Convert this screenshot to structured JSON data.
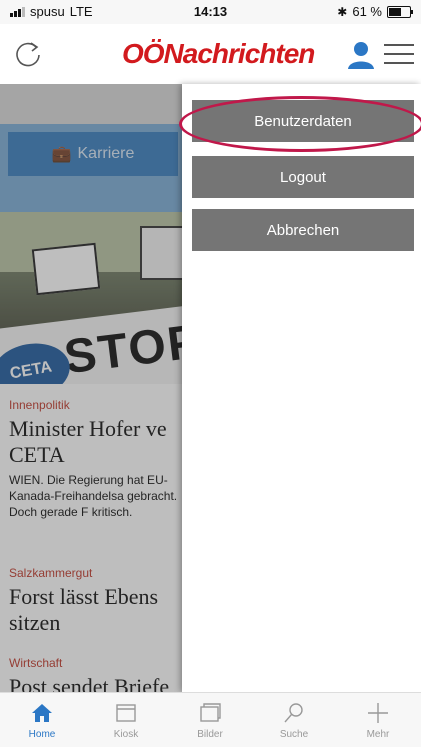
{
  "status": {
    "carrier": "spusu",
    "network": "LTE",
    "time": "14:13",
    "battery": "61 %",
    "battery_level": 0.61
  },
  "header": {
    "logo": "OÖNachrichten"
  },
  "background": {
    "karriere": "Karriere",
    "photo_text": {
      "banner": "STOPP",
      "badge": "CETA"
    },
    "articles": [
      {
        "category": "Innenpolitik",
        "headline": "Minister Hofer ve CETA",
        "teaser": "WIEN. Die Regierung hat EU-Kanada-Freihandelsa gebracht. Doch gerade F kritisch."
      },
      {
        "category": "Salzkammergut",
        "headline": "Forst lässt Ebens sitzen"
      },
      {
        "category": "Wirtschaft",
        "headline": "Post sendet Briefe"
      }
    ]
  },
  "menu": {
    "items": [
      "Benutzerdaten",
      "Logout",
      "Abbrechen"
    ]
  },
  "tabbar": {
    "tabs": [
      "Home",
      "Kiosk",
      "Bilder",
      "Suche",
      "Mehr"
    ]
  },
  "colors": {
    "brand": "#d21a1e",
    "accent": "#2b77c5",
    "menu_button": "#757575",
    "highlight": "#c0184a"
  }
}
